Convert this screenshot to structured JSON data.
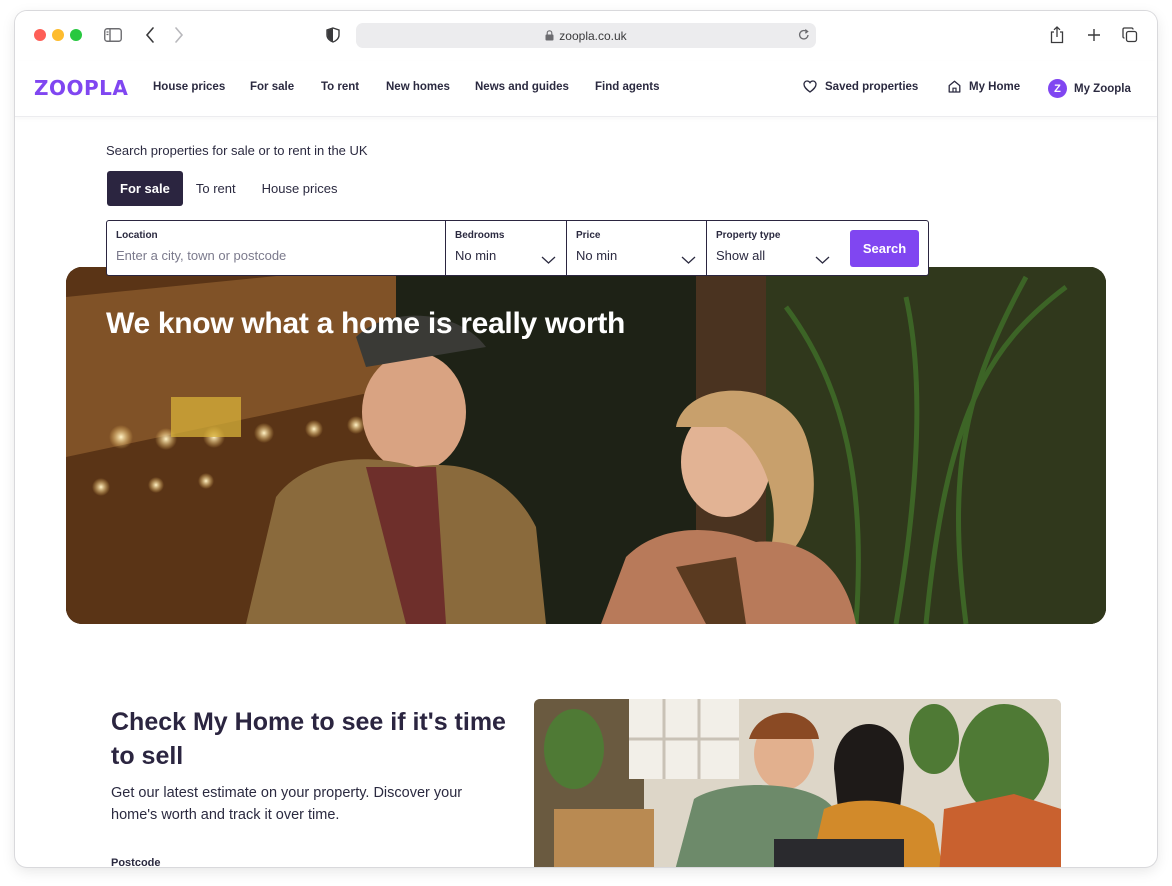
{
  "browser": {
    "url": "zoopla.co.uk"
  },
  "header": {
    "logo": "ZOOPLA",
    "nav": [
      "House prices",
      "For sale",
      "To rent",
      "New homes",
      "News and guides",
      "Find agents"
    ],
    "saved_properties": "Saved properties",
    "my_home": "My Home",
    "my_zoopla": "My Zoopla",
    "avatar_letter": "Z"
  },
  "search": {
    "heading": "Search properties for sale or to rent in the UK",
    "tabs": [
      "For sale",
      "To rent",
      "House prices"
    ],
    "active_tab": "For sale",
    "location_label": "Location",
    "location_placeholder": "Enter a city, town or postcode",
    "bedrooms_label": "Bedrooms",
    "bedrooms_value": "No min",
    "price_label": "Price",
    "price_value": "No min",
    "property_type_label": "Property type",
    "property_type_value": "Show all",
    "button": "Search"
  },
  "hero": {
    "title": "We know what a home is really worth"
  },
  "check_my_home": {
    "title": "Check My Home to see if it's time to sell",
    "description": "Get our latest estimate on your property. Discover your home's worth and track it over time.",
    "postcode_label": "Postcode"
  },
  "colors": {
    "brand": "#8046f1",
    "dark": "#2b2540"
  }
}
